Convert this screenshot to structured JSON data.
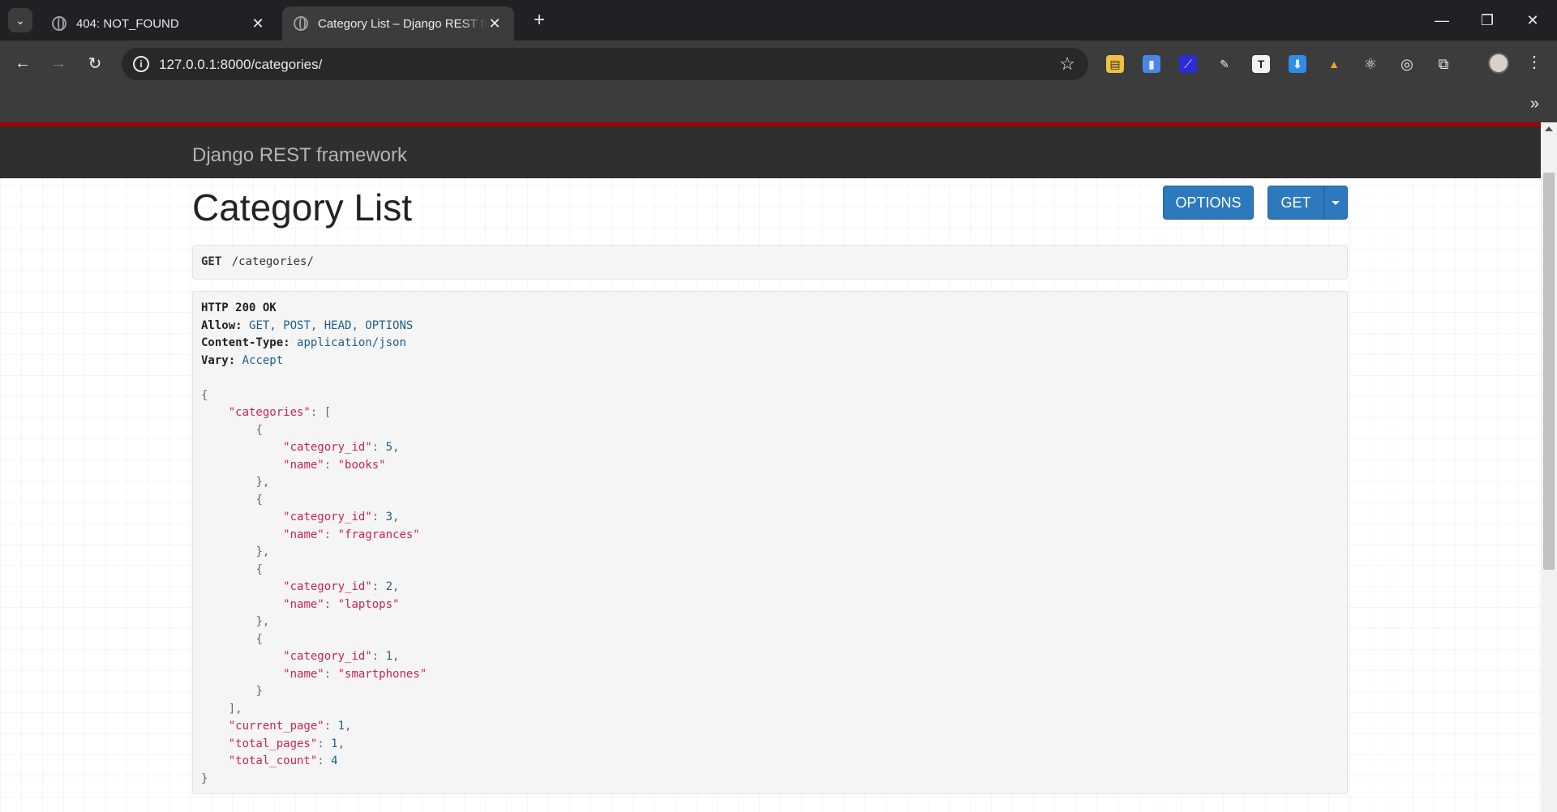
{
  "browser": {
    "tabs": [
      {
        "title": "404: NOT_FOUND",
        "active": false
      },
      {
        "title": "Category List – Django REST fra",
        "active": true
      }
    ],
    "url": "127.0.0.1:8000/categories/",
    "extension_icons": [
      "note-icon",
      "docs-icon",
      "picker-icon",
      "eyedropper-icon",
      "t-icon",
      "download-icon",
      "hat-icon",
      "react-icon",
      "target-icon",
      "puzzle-icon"
    ]
  },
  "drf": {
    "brand": "Django REST framework",
    "title": "Category List",
    "options_label": "OPTIONS",
    "get_label": "GET",
    "request_method": "GET",
    "request_path": "/categories/",
    "status": "HTTP 200 OK",
    "headers": [
      {
        "key": "Allow:",
        "value": "GET, POST, HEAD, OPTIONS"
      },
      {
        "key": "Content-Type:",
        "value": "application/json"
      },
      {
        "key": "Vary:",
        "value": "Accept"
      }
    ],
    "categories": [
      {
        "category_id": "5",
        "name": "\"books\""
      },
      {
        "category_id": "3",
        "name": "\"fragrances\""
      },
      {
        "category_id": "2",
        "name": "\"laptops\""
      },
      {
        "category_id": "1",
        "name": "\"smartphones\""
      }
    ],
    "current_page": "1",
    "total_pages": "1",
    "total_count": "4"
  },
  "colors": {
    "drf_navbar": "#2f2f2f",
    "drf_accent": "#a30000",
    "button": "#2c79bd"
  }
}
